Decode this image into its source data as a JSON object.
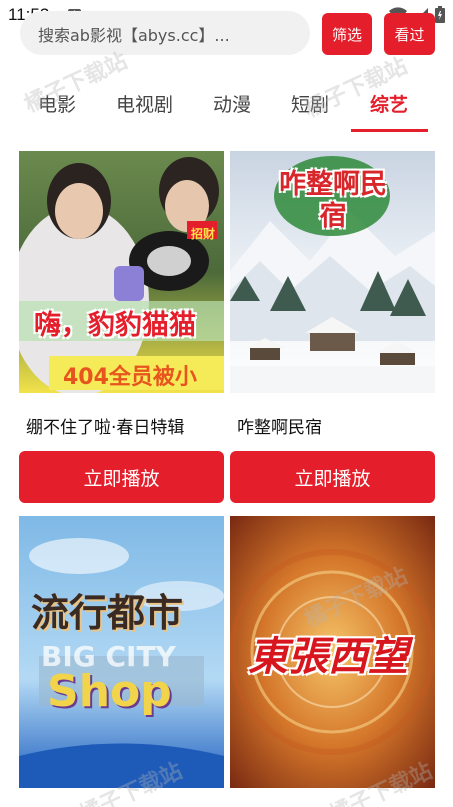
{
  "status_bar": {
    "time": "11:53",
    "badge": "A",
    "icons": [
      "wifi-icon",
      "signal-icon",
      "battery-icon"
    ]
  },
  "header": {
    "search_placeholder": "搜索ab影视【abys.cc】...",
    "filter_label": "筛选",
    "history_label": "看过"
  },
  "tabs": [
    {
      "label": "电影"
    },
    {
      "label": "电视剧"
    },
    {
      "label": "动漫"
    },
    {
      "label": "短剧"
    },
    {
      "label": "综艺",
      "active": true
    }
  ],
  "watermark_text": "橘子下载站",
  "cards": [
    {
      "title": "绷不住了啦·春日特辑",
      "play_label": "立即播放",
      "poster_text": "嗨，豹豹猫猫",
      "poster_sub": "404全员被小",
      "poster_badge": "招财"
    },
    {
      "title": "咋整啊民宿",
      "play_label": "立即播放",
      "poster_text": "咋整啊民宿"
    },
    {
      "title": "",
      "poster_text": "流行都市",
      "poster_sub": "BIG CITY",
      "poster_sub2": "Shop"
    },
    {
      "title": "",
      "poster_text": "東張西望"
    }
  ],
  "colors": {
    "accent": "#e41e2b",
    "search_bg": "#f1f1f1"
  }
}
